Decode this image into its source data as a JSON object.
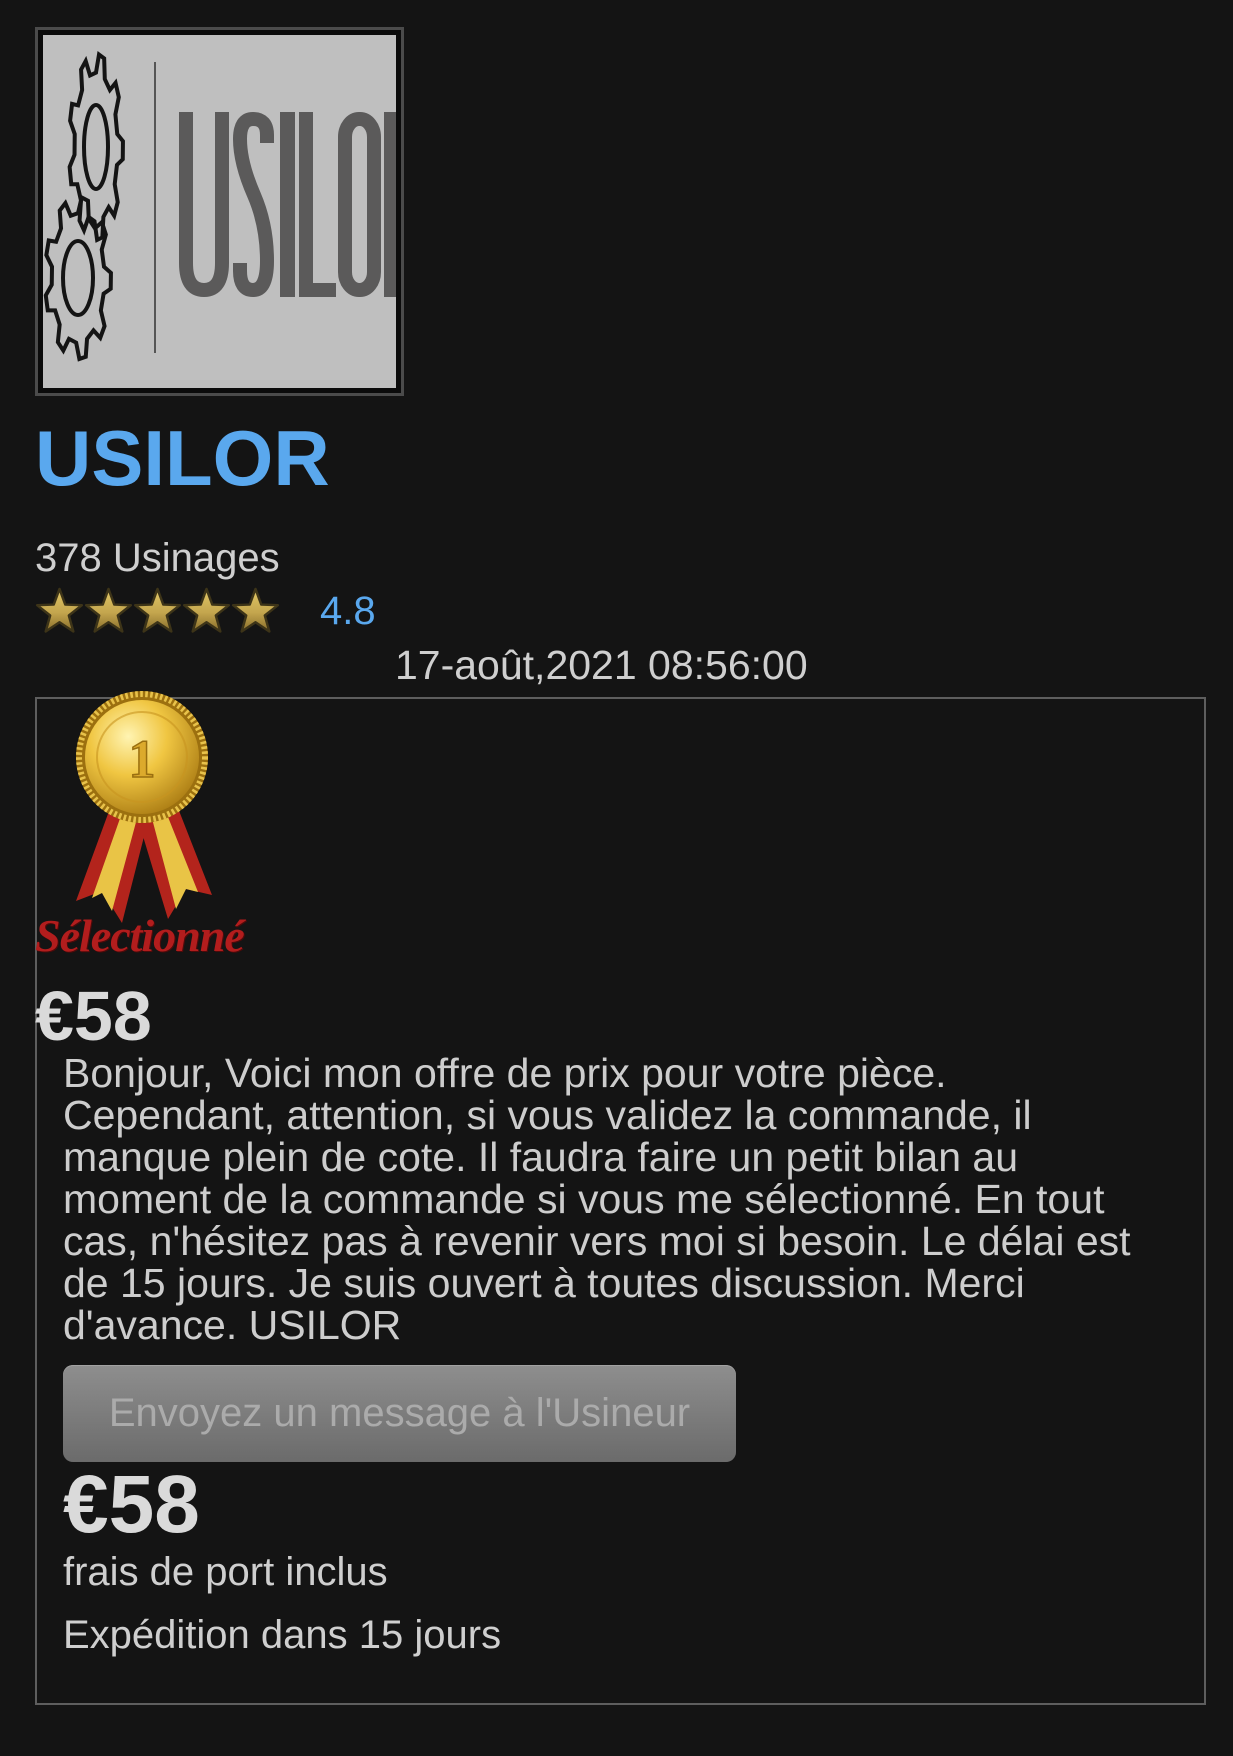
{
  "colors": {
    "background": "#141414",
    "text": "#cdcdcd",
    "accent": "#5aa8ee",
    "card_border": "#5e5e5e",
    "badge_red": "#b21d1d",
    "star_gold": "#c9ae55",
    "button": "#7b7b7b"
  },
  "logo": {
    "text": "USILOR",
    "icon": "gear-icon"
  },
  "machinist": {
    "name": "USILOR",
    "jobs_count": "378 Usinages",
    "rating": {
      "icon": "star-icon",
      "stars_filled": 5,
      "stars_total": 5,
      "value": "4.8"
    }
  },
  "offer": {
    "date": "17-août,2021 08:56:00",
    "badge": {
      "icon": "medal-icon",
      "medal_number": "1",
      "label": "Sélectionné"
    },
    "price": "€58",
    "message_lines": [
      "Bonjour, Voici mon offre de prix pour votre pièce.",
      "Cependant, attention, si vous validez la commande, il",
      "manque plein de cote. Il faudra faire un petit bilan au",
      "moment de la commande si vous me sélectionné. En tout",
      "cas, n'hésitez pas à revenir vers moi si besoin. Le délai est",
      "de 15 jours. Je suis ouvert à toutes discussion. Merci",
      "d'avance. USILOR"
    ],
    "contact_button_label": "Envoyez un message à l'Usineur",
    "total_price": "€58",
    "shipping_note": "frais de port inclus",
    "shipping_delay": "Expédition dans 15 jours"
  }
}
